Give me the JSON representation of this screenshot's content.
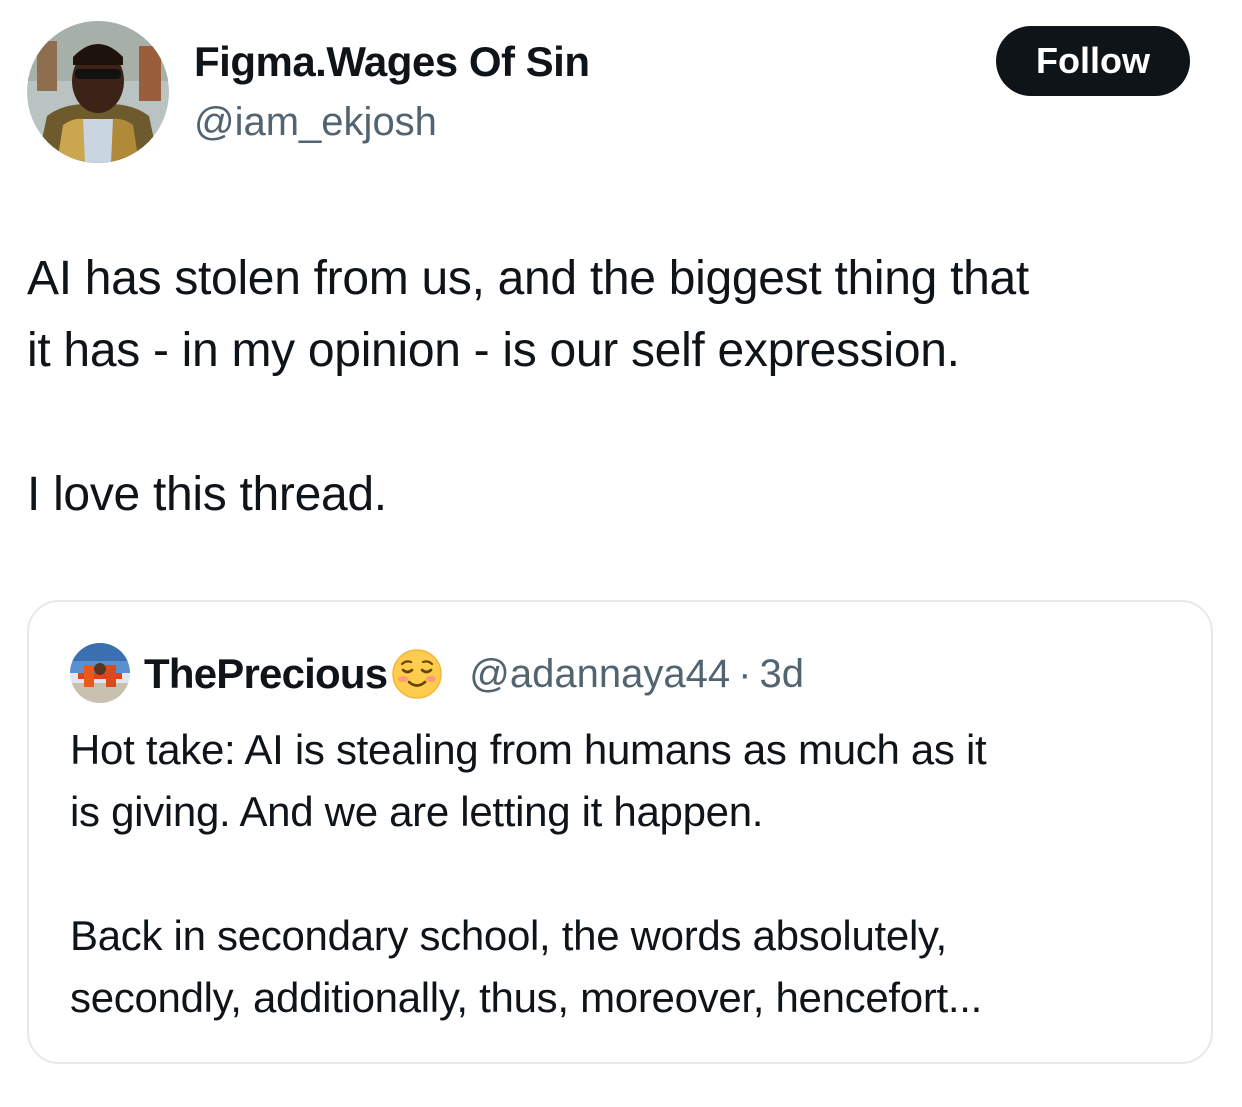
{
  "author": {
    "display_name": "Figma.Wages Of Sin",
    "handle": "@iam_ekjosh"
  },
  "follow_label": "Follow",
  "tweet": {
    "lines": [
      "AI has stolen from us, and the biggest thing that",
      "it has - in my opinion - is our self expression.",
      "I love this thread."
    ]
  },
  "quoted_tweet": {
    "display_name": "ThePrecious",
    "emoji": "relieved-face-emoji",
    "handle": "@adannaya44",
    "separator": "·",
    "time": "3d",
    "lines": [
      "Hot take: AI is stealing from humans as much as it",
      "is giving. And we are letting it happen.",
      "Back in secondary school, the words absolutely,",
      "secondly, additionally, thus, moreover, hencefort..."
    ]
  },
  "colors": {
    "text_primary": "#0f1419",
    "text_secondary": "#536471",
    "button_bg": "#0f1419",
    "border": "#e6e9ec"
  }
}
